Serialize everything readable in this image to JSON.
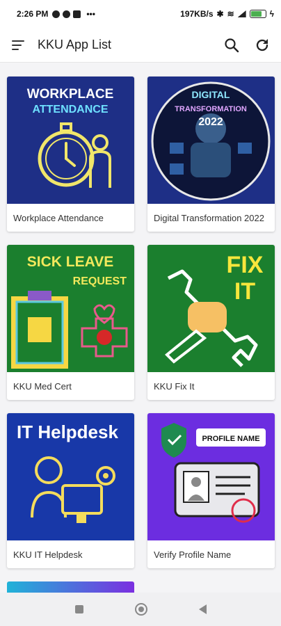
{
  "status_bar": {
    "time": "2:26 PM",
    "speed": "197KB/s",
    "battery_color": "#4caf50"
  },
  "app_bar": {
    "title": "KKU App List",
    "menu_icon": "menu-icon",
    "search_icon": "search-icon",
    "refresh_icon": "refresh-icon"
  },
  "apps": [
    {
      "label": "Workplace Attendance",
      "art_line1": "WORKPLACE",
      "art_line2": "ATTENDANCE",
      "bg": "#1e2f86"
    },
    {
      "label": "Digital Transformation 2022",
      "art_line1": "DIGITAL",
      "art_line2": "TRANSFORMATION",
      "art_line3": "2022",
      "bg": "#1e2f86"
    },
    {
      "label": "KKU Med Cert",
      "art_line1": "SICK LEAVE",
      "art_line2": "REQUEST",
      "bg": "#1b7f2e"
    },
    {
      "label": "KKU Fix It",
      "art_line1": "FIX",
      "art_line2": "IT",
      "bg": "#1b7f2e"
    },
    {
      "label": "KKU IT Helpdesk",
      "art_line1": "IT Helpdesk",
      "bg": "#1838a8"
    },
    {
      "label": "Verify Profile Name",
      "art_line1": "PROFILE NAME",
      "bg": "#6c2de0"
    }
  ]
}
